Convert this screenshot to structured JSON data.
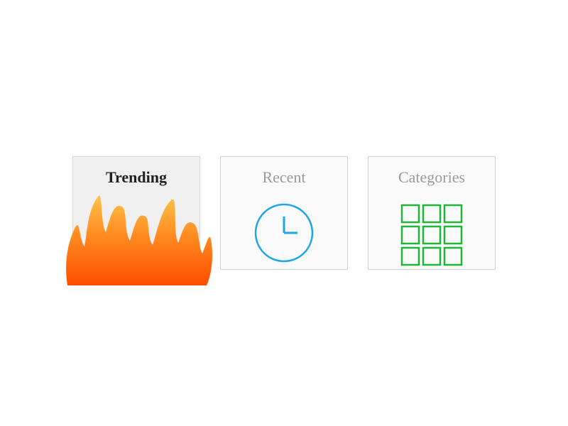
{
  "tiles": {
    "trending": {
      "label": "Trending"
    },
    "recent": {
      "label": "Recent"
    },
    "categories": {
      "label": "Categories"
    }
  },
  "colors": {
    "flame_top": "#ffb23e",
    "flame_bottom": "#ff5a00",
    "clock": "#1ea7e8",
    "grid": "#1fb63a"
  }
}
